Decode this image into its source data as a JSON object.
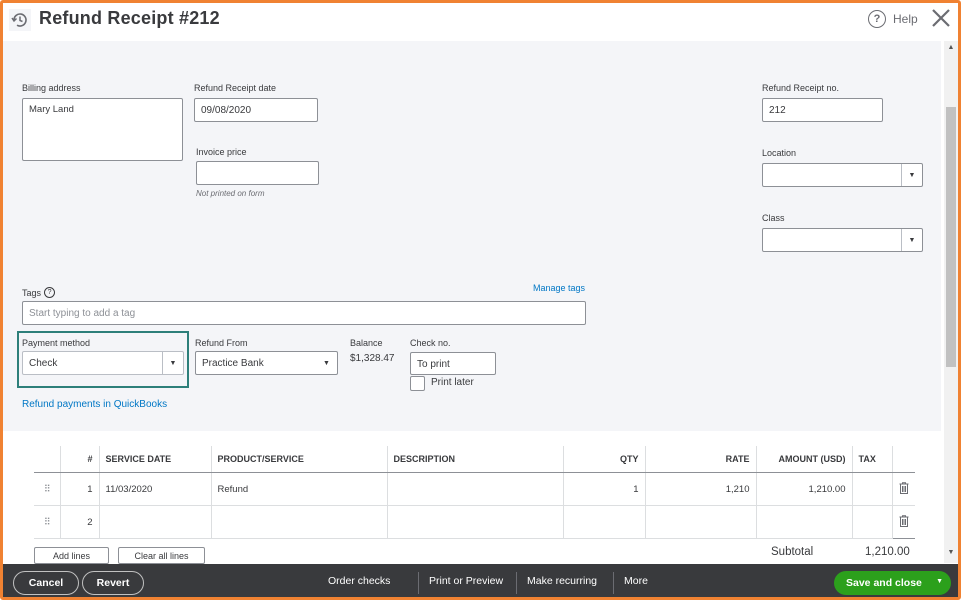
{
  "header": {
    "title": "Refund Receipt #212",
    "help_label": "Help"
  },
  "billing": {
    "label": "Billing address",
    "value": "Mary Land"
  },
  "receipt_date": {
    "label": "Refund Receipt date",
    "value": "09/08/2020"
  },
  "invoice_price": {
    "label": "Invoice price",
    "value": "",
    "note": "Not printed on form"
  },
  "receipt_no": {
    "label": "Refund Receipt no.",
    "value": "212"
  },
  "location": {
    "label": "Location",
    "value": ""
  },
  "class_field": {
    "label": "Class",
    "value": ""
  },
  "tags": {
    "label": "Tags",
    "placeholder": "Start typing to add a tag",
    "manage_label": "Manage tags"
  },
  "payment_method": {
    "label": "Payment method",
    "value": "Check"
  },
  "refund_from": {
    "label": "Refund From",
    "value": "Practice Bank"
  },
  "balance": {
    "label": "Balance",
    "value": "$1,328.47"
  },
  "check_no": {
    "label": "Check no.",
    "value": "To print",
    "print_later_label": "Print later",
    "print_later_checked": false
  },
  "refund_link": "Refund payments in QuickBooks",
  "table": {
    "headers": [
      "#",
      "SERVICE DATE",
      "PRODUCT/SERVICE",
      "DESCRIPTION",
      "QTY",
      "RATE",
      "AMOUNT (USD)",
      "TAX"
    ],
    "rows": [
      {
        "num": "1",
        "service_date": "11/03/2020",
        "product": "Refund",
        "description": "",
        "qty": "1",
        "rate": "1,210",
        "amount": "1,210.00",
        "tax": ""
      },
      {
        "num": "2",
        "service_date": "",
        "product": "",
        "description": "",
        "qty": "",
        "rate": "",
        "amount": "",
        "tax": ""
      }
    ],
    "add_lines_label": "Add lines",
    "clear_lines_label": "Clear all lines"
  },
  "subtotal": {
    "label": "Subtotal",
    "value": "1,210.00"
  },
  "footer": {
    "cancel_label": "Cancel",
    "revert_label": "Revert",
    "order_checks_label": "Order checks",
    "print_preview_label": "Print or Preview",
    "make_recurring_label": "Make recurring",
    "more_label": "More",
    "save_close_label": "Save and close"
  },
  "colors": {
    "frame_border": "#f08232",
    "save_green": "#2ca01c",
    "footer_bg": "#393a3d",
    "link_blue": "#0077c5",
    "highlight_teal": "#2d7f7a"
  }
}
